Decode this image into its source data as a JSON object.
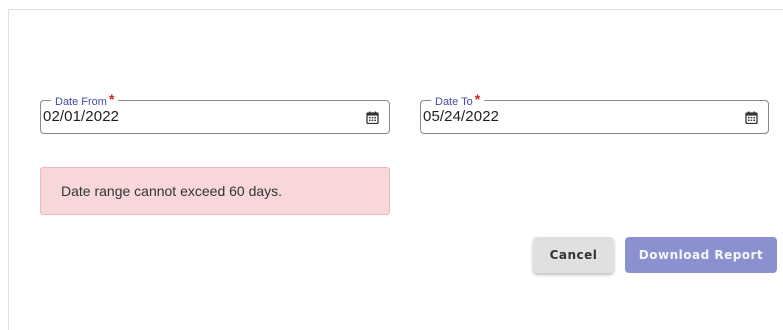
{
  "form": {
    "date_from": {
      "label": "Date From",
      "required_mark": "*",
      "value": "02/01/2022",
      "icon": "calendar-icon"
    },
    "date_to": {
      "label": "Date To",
      "required_mark": "*",
      "value": "05/24/2022",
      "icon": "calendar-icon"
    }
  },
  "alert": {
    "message": "Date range cannot exceed 60 days.",
    "type": "error",
    "background_color": "#f7d7da"
  },
  "actions": {
    "cancel_label": "Cancel",
    "download_label": "Download Report",
    "download_disabled": true,
    "accent_color": "#8b91cf"
  },
  "colors": {
    "label": "#3f4aa8",
    "required": "#c62828"
  }
}
